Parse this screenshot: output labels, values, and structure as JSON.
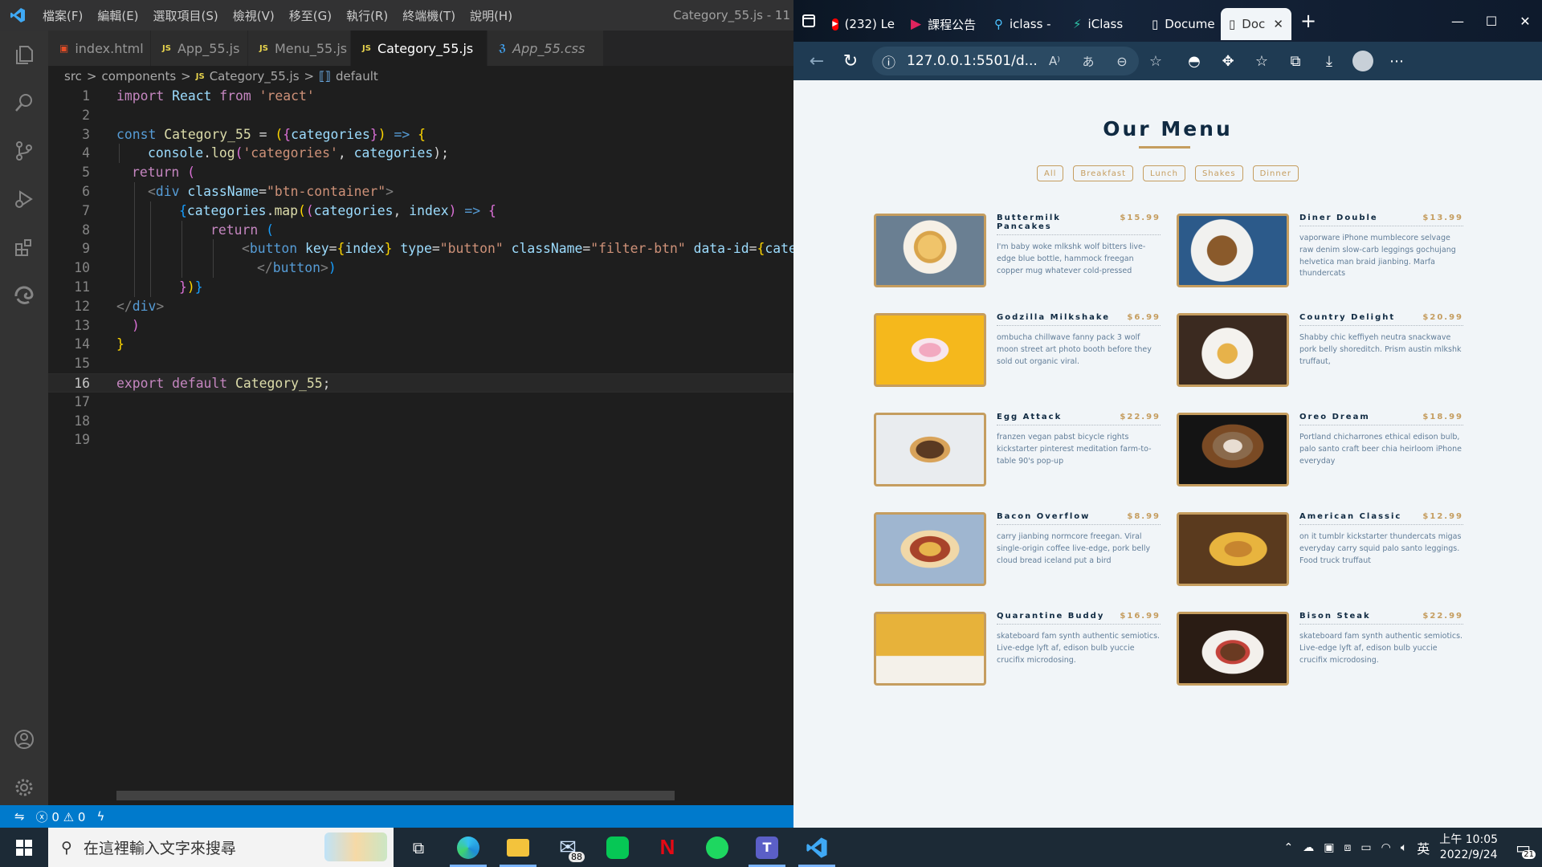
{
  "vscode": {
    "menus": [
      "檔案(F)",
      "編輯(E)",
      "選取項目(S)",
      "檢視(V)",
      "移至(G)",
      "執行(R)",
      "終端機(T)",
      "說明(H)"
    ],
    "window_title": "Category_55.js - 11",
    "tabs": [
      {
        "icon": "html",
        "label": "index.html"
      },
      {
        "icon": "JS",
        "label": "App_55.js"
      },
      {
        "icon": "JS",
        "label": "Menu_55.js"
      },
      {
        "icon": "JS",
        "label": "Category_55.js",
        "active": true
      },
      {
        "icon": "CSS",
        "label": "App_55.css"
      }
    ],
    "breadcrumb": {
      "src": "src",
      "sep1": ">",
      "components": "components",
      "sep2": ">",
      "file": "Category_55.js",
      "sep3": ">",
      "symbol": "default"
    },
    "lines": [
      "1",
      "2",
      "3",
      "4",
      "5",
      "6",
      "7",
      "8",
      "9",
      "10",
      "11",
      "12",
      "13",
      "14",
      "15",
      "16",
      "17",
      "18",
      "19"
    ],
    "code": {
      "l1": {
        "a": "import",
        "b": " React ",
        "c": "from",
        "d": " 'react'"
      },
      "l3": {
        "a": "const",
        "b": " Category_55 ",
        "c": "=",
        "d": " (",
        "e": "{",
        "f": "categories",
        "g": "}",
        "h": ")",
        "i": " => ",
        "j": "{"
      },
      "l4": {
        "a": "console",
        "b": ".",
        "c": "log",
        "d": "(",
        "e": "'categories'",
        "f": ", ",
        "g": "categories",
        "h": ");"
      },
      "l5": {
        "a": "return",
        "b": " ("
      },
      "l6": {
        "a": "<",
        "b": "div",
        "c": " className",
        "d": "=",
        "e": "\"btn-container\"",
        "f": ">"
      },
      "l7": {
        "a": "{",
        "b": "categories",
        "c": ".",
        "d": "map",
        "e": "(",
        "f": "(",
        "g": "categories",
        "h": ", ",
        "i": "index",
        "j": ")",
        "k": " => ",
        "l": "{"
      },
      "l8": {
        "a": "return",
        "b": " ("
      },
      "l9": {
        "a": "<",
        "b": "button",
        "c": " key",
        "d": "=",
        "e": "{",
        "f": "index",
        "g": "}",
        "h": " type",
        "i": "=",
        "j": "\"button\"",
        "k": " className",
        "l": "=",
        "m": "\"filter-btn\"",
        "n": " data-id",
        "o": "=",
        "p": "{",
        "q": "catego"
      },
      "l10": {
        "a": "</",
        "b": "button",
        "c": ">",
        "d": ")"
      },
      "l11": {
        "a": "}",
        "b": ")",
        "c": "}"
      },
      "l12": {
        "a": "</",
        "b": "div",
        "c": ">"
      },
      "l13": {
        "a": ")"
      },
      "l14": {
        "a": "}"
      },
      "l16": {
        "a": "export",
        "b": " default ",
        "c": "Category_55",
        "d": ";"
      }
    },
    "status": {
      "errors": "0",
      "warnings": "0"
    }
  },
  "browser": {
    "tabs": [
      {
        "icon": "youtube-icon",
        "label": "(232) Le"
      },
      {
        "icon": "play-icon",
        "label": "課程公告"
      },
      {
        "icon": "search-icon",
        "label": "iclass -"
      },
      {
        "icon": "iclass-icon",
        "label": "iClass"
      },
      {
        "icon": "document-icon",
        "label": "Docume"
      },
      {
        "icon": "document-icon",
        "label": "Doc",
        "active": true
      }
    ],
    "url": "127.0.0.1:5501/d...",
    "page": {
      "title": "Our Menu",
      "filters": [
        "All",
        "Breakfast",
        "Lunch",
        "Shakes",
        "Dinner"
      ],
      "items": [
        {
          "name": "Buttermilk Pancakes",
          "price": "$15.99",
          "desc": "I'm baby woke mlkshk wolf bitters live-edge blue bottle, hammock freegan copper mug whatever cold-pressed"
        },
        {
          "name": "Diner Double",
          "price": "$13.99",
          "desc": "vaporware iPhone mumblecore selvage raw denim slow-carb leggings gochujang helvetica man braid jianbing. Marfa thundercats"
        },
        {
          "name": "Godzilla Milkshake",
          "price": "$6.99",
          "desc": "ombucha chillwave fanny pack 3 wolf moon street art photo booth before they sold out organic viral."
        },
        {
          "name": "Country Delight",
          "price": "$20.99",
          "desc": "Shabby chic keffiyeh neutra snackwave pork belly shoreditch. Prism austin mlkshk truffaut,"
        },
        {
          "name": "Egg Attack",
          "price": "$22.99",
          "desc": "franzen vegan pabst bicycle rights kickstarter pinterest meditation farm-to-table 90's pop-up"
        },
        {
          "name": "Oreo Dream",
          "price": "$18.99",
          "desc": "Portland chicharrones ethical edison bulb, palo santo craft beer chia heirloom iPhone everyday"
        },
        {
          "name": "Bacon Overflow",
          "price": "$8.99",
          "desc": "carry jianbing normcore freegan. Viral single-origin coffee live-edge, pork belly cloud bread iceland put a bird"
        },
        {
          "name": "American Classic",
          "price": "$12.99",
          "desc": "on it tumblr kickstarter thundercats migas everyday carry squid palo santo leggings. Food truck truffaut"
        },
        {
          "name": "Quarantine Buddy",
          "price": "$16.99",
          "desc": "skateboard fam synth authentic semiotics. Live-edge lyft af, edison bulb yuccie crucifix microdosing."
        },
        {
          "name": "Bison Steak",
          "price": "$22.99",
          "desc": "skateboard fam synth authentic semiotics. Live-edge lyft af, edison bulb yuccie crucifix microdosing."
        }
      ]
    }
  },
  "taskbar": {
    "search_placeholder": "在這裡輸入文字來搜尋",
    "mail_badge": "88",
    "ime": "英",
    "time": "上午 10:05",
    "date": "2022/9/24",
    "notification_count": "21"
  },
  "colors": {
    "accent": "#c59d5f",
    "heading": "#102a42",
    "vscode_status": "#007acc"
  }
}
